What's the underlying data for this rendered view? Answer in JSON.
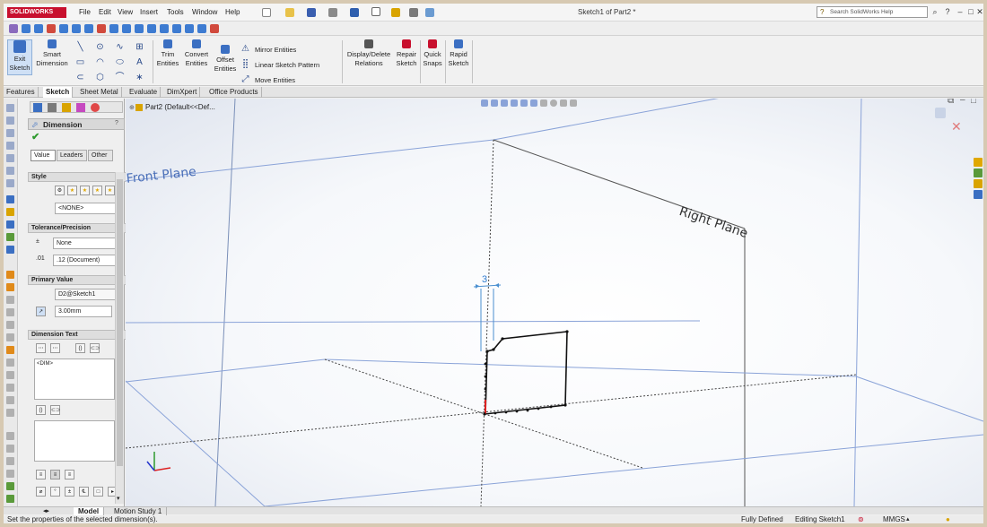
{
  "app": {
    "logo_text": "SOLIDWORKS",
    "document_title": "Sketch1 of Part2 *"
  },
  "menu": [
    "File",
    "Edit",
    "View",
    "Insert",
    "Tools",
    "Window",
    "Help"
  ],
  "search": {
    "placeholder": "Search SolidWorks Help"
  },
  "commands": {
    "exit_sketch": [
      "Exit",
      "Sketch"
    ],
    "smart_dimension": [
      "Smart",
      "Dimension"
    ],
    "trim_entities": [
      "Trim",
      "Entities"
    ],
    "convert_entities": [
      "Convert",
      "Entities"
    ],
    "offset_entities": [
      "Offset",
      "Entities"
    ],
    "mirror_entities": "Mirror Entities",
    "linear_sketch_pattern": "Linear Sketch Pattern",
    "move_entities": "Move Entities",
    "display_delete_relations": [
      "Display/Delete",
      "Relations"
    ],
    "repair_sketch": [
      "Repair",
      "Sketch"
    ],
    "quick_snaps": [
      "Quick",
      "Snaps"
    ],
    "rapid_sketch": [
      "Rapid",
      "Sketch"
    ]
  },
  "tabs": [
    "Features",
    "Sketch",
    "Sheet Metal",
    "Evaluate",
    "DimXpert",
    "Office Products"
  ],
  "active_tab": "Sketch",
  "property_manager": {
    "title": "Dimension",
    "tabs": [
      "Value",
      "Leaders",
      "Other"
    ],
    "style": {
      "label": "Style",
      "value": "<NONE>"
    },
    "tolerance": {
      "label": "Tolerance/Precision",
      "tolerance_value": "None",
      "precision_value": ".12 (Document)"
    },
    "primary_value": {
      "label": "Primary Value",
      "name": "D2@Sketch1",
      "value": "3.00mm"
    },
    "dimension_text": {
      "label": "Dimension Text",
      "text": "<DIM>"
    }
  },
  "feature_tree": {
    "root": "Part2  (Default<<Def..."
  },
  "graphics": {
    "front_plane_label": "Front Plane",
    "right_plane_label": "Right Plane",
    "dimension_value": "3"
  },
  "bottom_tabs": [
    "Model",
    "Motion Study 1"
  ],
  "status": {
    "message": "Set the properties of the selected dimension(s).",
    "definition": "Fully Defined",
    "mode": "Editing Sketch1",
    "units": "MMGS"
  },
  "colors": {
    "accent_red": "#c8102e",
    "sketch_blue": "#4a8fd0",
    "plane_blue": "#8aa3d8"
  }
}
